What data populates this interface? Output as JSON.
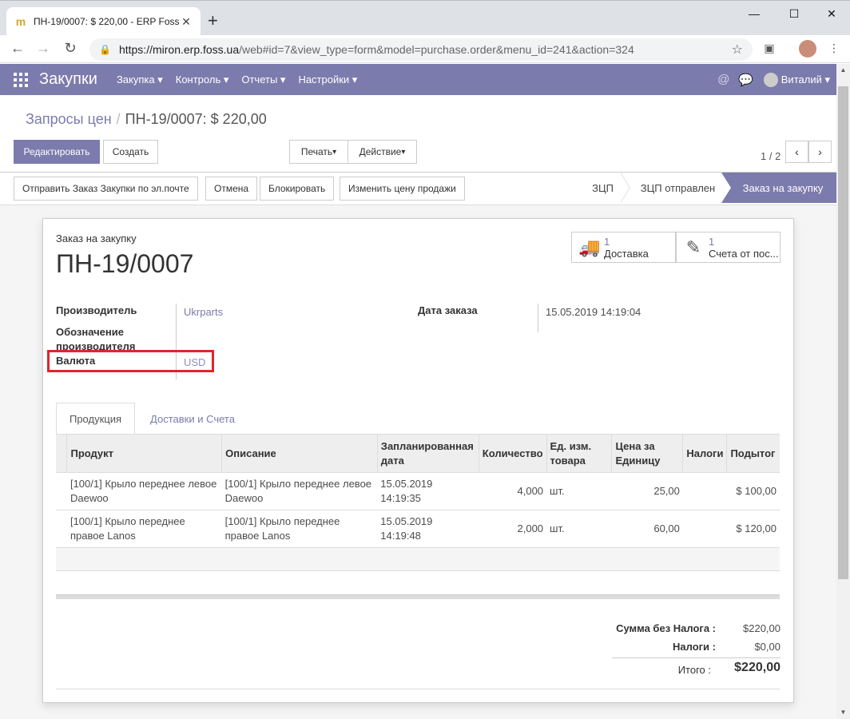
{
  "browser": {
    "tab_title": "ПН-19/0007: $ 220,00 - ERP Foss",
    "url_host": "https://miron.erp.foss.ua",
    "url_path": "/web#id=7&view_type=form&model=purchase.order&menu_id=241&action=324"
  },
  "nav": {
    "brand": "Закупки",
    "menus": [
      "Закупка",
      "Контроль",
      "Отчеты",
      "Настройки"
    ],
    "user": "Виталий"
  },
  "breadcrumb": {
    "parent": "Запросы цен",
    "current": "ПН-19/0007: $ 220,00"
  },
  "toolbar": {
    "edit": "Редактировать",
    "create": "Создать",
    "print": "Печать",
    "action": "Действие",
    "pager": "1 / 2"
  },
  "statusbar": {
    "buttons": [
      "Отправить Заказ Закупки по эл.почте",
      "Отмена",
      "Блокировать",
      "Изменить цену продажи"
    ],
    "stages": [
      "ЗЦП",
      "ЗЦП отправлен",
      "Заказ на закупку"
    ]
  },
  "sheet": {
    "subtitle": "Заказ на закупку",
    "name": "ПН-19/0007",
    "smart_buttons": [
      {
        "count": "1",
        "label": "Доставка",
        "icon": "truck-icon"
      },
      {
        "count": "1",
        "label": "Счета от пос...",
        "icon": "edit-icon"
      }
    ],
    "fields": {
      "vendor_label": "Производитель",
      "vendor": "Ukrparts",
      "vendor_ref_label": "Обозначение производителя",
      "currency_label": "Валюта",
      "currency": "USD",
      "date_label": "Дата заказа",
      "date": "15.05.2019 14:19:04"
    },
    "tabs": [
      "Продукция",
      "Доставки и Счета"
    ],
    "columns": [
      "Продукт",
      "Описание",
      "Запланированная дата",
      "Количество",
      "Ед. изм. товара",
      "Цена за Единицу",
      "Налоги",
      "Подытог"
    ],
    "rows": [
      {
        "product": "[100/1] Крыло переднее левое Daewoo",
        "description": "[100/1] Крыло переднее левое Daewoo",
        "date": "15.05.2019 14:19:35",
        "qty": "4,000",
        "uom": "шт.",
        "price": "25,00",
        "taxes": "",
        "subtotal": "$ 100,00"
      },
      {
        "product": "[100/1] Крыло переднее правое Lanos",
        "description": "[100/1] Крыло переднее правое Lanos",
        "date": "15.05.2019 14:19:48",
        "qty": "2,000",
        "uom": "шт.",
        "price": "60,00",
        "taxes": "",
        "subtotal": "$ 120,00"
      }
    ],
    "totals": {
      "untaxed_label": "Сумма без Налога :",
      "untaxed": "$220,00",
      "taxes_label": "Налоги :",
      "taxes": "$0,00",
      "total_label": "Итого :",
      "total": "$220,00"
    }
  }
}
